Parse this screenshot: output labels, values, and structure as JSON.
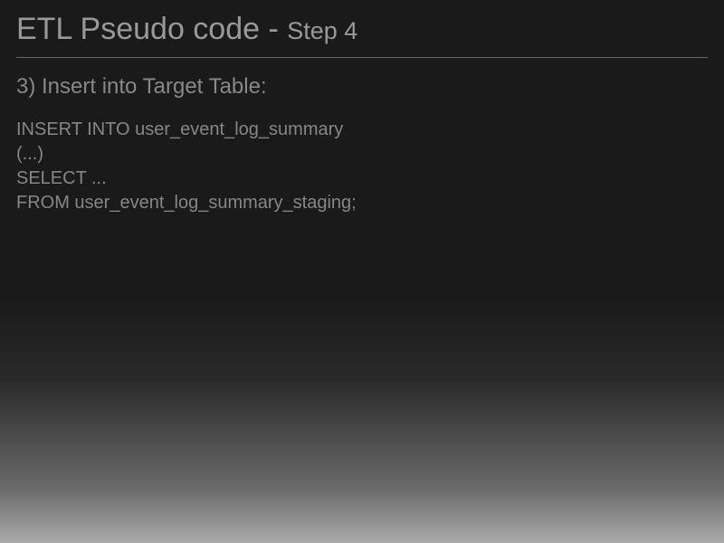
{
  "slide": {
    "title_main": "ETL Pseudo code - ",
    "title_sub": "Step 4",
    "subheading": "3) Insert into Target Table:",
    "code": {
      "line1": "INSERT INTO user_event_log_summary",
      "line2": "(...)",
      "line3": "SELECT ...",
      "line4": "FROM user_event_log_summary_staging;"
    }
  }
}
